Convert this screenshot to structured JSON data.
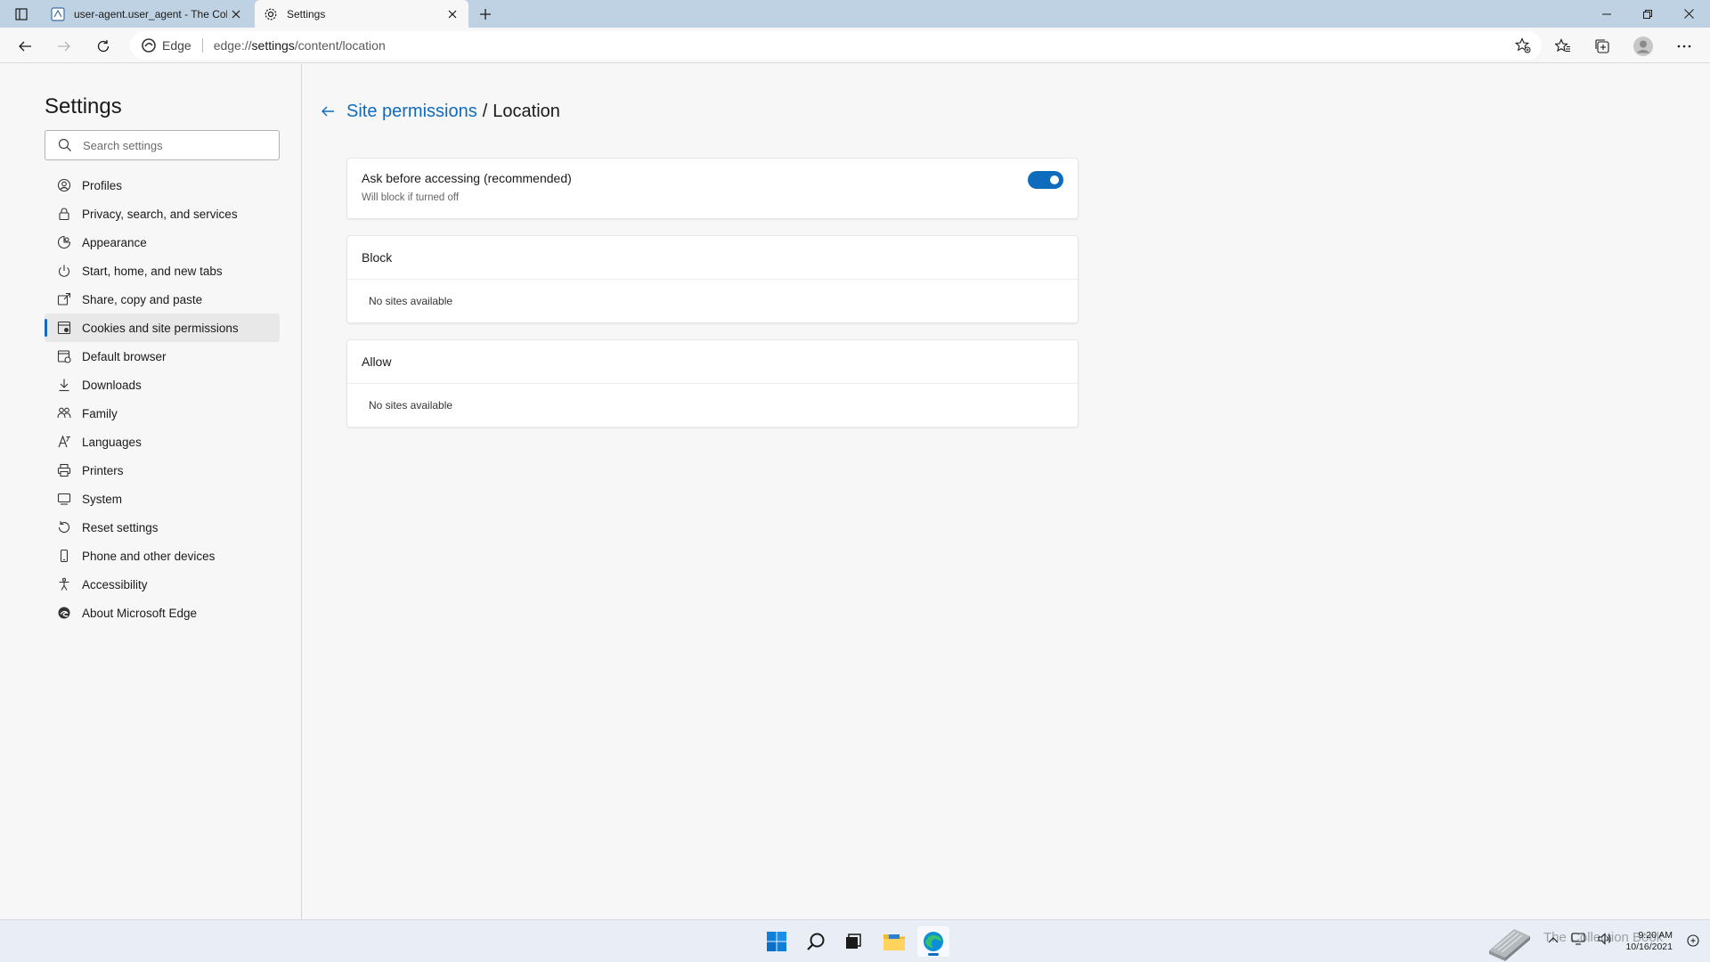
{
  "browser": {
    "tabs": [
      {
        "title": "user-agent.user_agent - The Coll",
        "active": false
      },
      {
        "title": "Settings",
        "active": true
      }
    ],
    "address": {
      "site_label": "Edge",
      "url_prefix": "edge://",
      "url_path": "settings",
      "url_rest": "/content/location"
    }
  },
  "sidebar": {
    "title": "Settings",
    "search_placeholder": "Search settings",
    "items": [
      {
        "label": "Profiles",
        "icon": "profile-icon"
      },
      {
        "label": "Privacy, search, and services",
        "icon": "lock-icon"
      },
      {
        "label": "Appearance",
        "icon": "appearance-icon"
      },
      {
        "label": "Start, home, and new tabs",
        "icon": "power-icon"
      },
      {
        "label": "Share, copy and paste",
        "icon": "share-icon"
      },
      {
        "label": "Cookies and site permissions",
        "icon": "cookies-icon",
        "selected": true
      },
      {
        "label": "Default browser",
        "icon": "browser-icon"
      },
      {
        "label": "Downloads",
        "icon": "download-icon"
      },
      {
        "label": "Family",
        "icon": "family-icon"
      },
      {
        "label": "Languages",
        "icon": "languages-icon"
      },
      {
        "label": "Printers",
        "icon": "printer-icon"
      },
      {
        "label": "System",
        "icon": "system-icon"
      },
      {
        "label": "Reset settings",
        "icon": "reset-icon"
      },
      {
        "label": "Phone and other devices",
        "icon": "phone-icon"
      },
      {
        "label": "Accessibility",
        "icon": "accessibility-icon"
      },
      {
        "label": "About Microsoft Edge",
        "icon": "edge-logo-icon"
      }
    ]
  },
  "main": {
    "breadcrumb_parent": "Site permissions",
    "breadcrumb_separator": "/",
    "breadcrumb_current": "Location",
    "ask": {
      "label": "Ask before accessing (recommended)",
      "sublabel": "Will block if turned off",
      "enabled": true
    },
    "block": {
      "heading": "Block",
      "empty": "No sites available"
    },
    "allow": {
      "heading": "Allow",
      "empty": "No sites available"
    }
  },
  "taskbar": {
    "time": "9:20 AM",
    "date": "10/16/2021",
    "watermark": "The Collection Book"
  },
  "colors": {
    "accent": "#0f6cbd",
    "tabbar": "#bfd2e3",
    "page_bg": "#f7f7f7"
  }
}
